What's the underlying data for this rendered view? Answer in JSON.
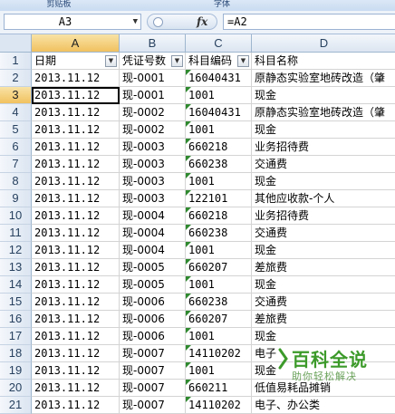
{
  "ribbon": {
    "groups": [
      "剪贴板",
      "字体"
    ]
  },
  "formula_bar": {
    "name_box": "A3",
    "fx_label": "fx",
    "formula": "=A2"
  },
  "columns": [
    "A",
    "B",
    "C",
    "D"
  ],
  "active_column": "A",
  "active_row": 3,
  "rows": [
    {
      "num": "1",
      "a": "日期",
      "b": "凭证号数",
      "c": "科目编码",
      "d": "科目名称"
    },
    {
      "num": "2",
      "a": "2013.11.12",
      "b": "现-0001",
      "c": "16040431",
      "d": "原静态实验室地砖改造（肇"
    },
    {
      "num": "3",
      "a": "2013.11.12",
      "b": "现-0001",
      "c": "1001",
      "d": "现金"
    },
    {
      "num": "4",
      "a": "2013.11.12",
      "b": "现-0002",
      "c": "16040431",
      "d": "原静态实验室地砖改造（肇"
    },
    {
      "num": "5",
      "a": "2013.11.12",
      "b": "现-0002",
      "c": "1001",
      "d": "现金"
    },
    {
      "num": "6",
      "a": "2013.11.12",
      "b": "现-0003",
      "c": "660218",
      "d": "业务招待费"
    },
    {
      "num": "7",
      "a": "2013.11.12",
      "b": "现-0003",
      "c": "660238",
      "d": "交通费"
    },
    {
      "num": "8",
      "a": "2013.11.12",
      "b": "现-0003",
      "c": "1001",
      "d": "现金"
    },
    {
      "num": "9",
      "a": "2013.11.12",
      "b": "现-0003",
      "c": "122101",
      "d": "其他应收款-个人"
    },
    {
      "num": "10",
      "a": "2013.11.12",
      "b": "现-0004",
      "c": "660218",
      "d": "业务招待费"
    },
    {
      "num": "11",
      "a": "2013.11.12",
      "b": "现-0004",
      "c": "660238",
      "d": "交通费"
    },
    {
      "num": "12",
      "a": "2013.11.12",
      "b": "现-0004",
      "c": "1001",
      "d": "现金"
    },
    {
      "num": "13",
      "a": "2013.11.12",
      "b": "现-0005",
      "c": "660207",
      "d": "差旅费"
    },
    {
      "num": "14",
      "a": "2013.11.12",
      "b": "现-0005",
      "c": "1001",
      "d": "现金"
    },
    {
      "num": "15",
      "a": "2013.11.12",
      "b": "现-0006",
      "c": "660238",
      "d": "交通费"
    },
    {
      "num": "16",
      "a": "2013.11.12",
      "b": "现-0006",
      "c": "660207",
      "d": "差旅费"
    },
    {
      "num": "17",
      "a": "2013.11.12",
      "b": "现-0006",
      "c": "1001",
      "d": "现金"
    },
    {
      "num": "18",
      "a": "2013.11.12",
      "b": "现-0007",
      "c": "14110202",
      "d": "电子"
    },
    {
      "num": "19",
      "a": "2013.11.12",
      "b": "现-0007",
      "c": "1001",
      "d": "现金"
    },
    {
      "num": "20",
      "a": "2013.11.12",
      "b": "现-0007",
      "c": "660211",
      "d": "低值易耗品摊销"
    },
    {
      "num": "21",
      "a": "2013.11.12",
      "b": "现-0007",
      "c": "14110202",
      "d": "电子、办公类"
    }
  ],
  "watermark": {
    "title": "百科全说",
    "subtitle": "助你轻松解决"
  }
}
